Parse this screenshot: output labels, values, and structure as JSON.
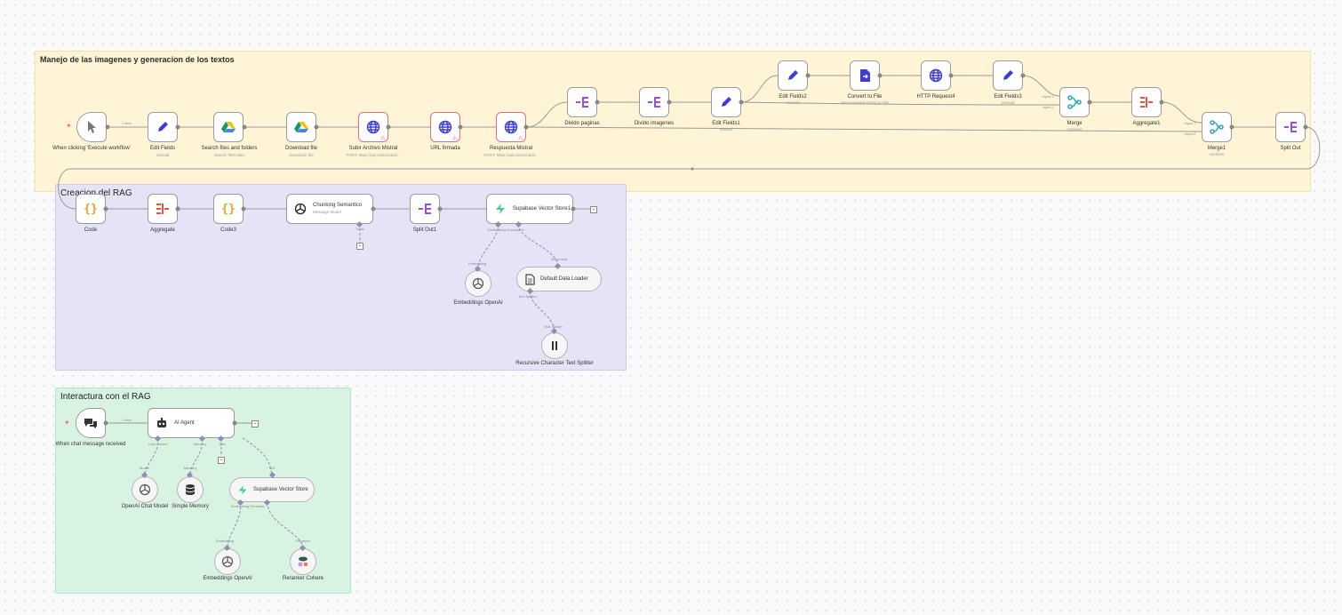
{
  "sticky": {
    "manejo": "Manejo de las imagenes y generacion de los textos",
    "rag": "Creacion del RAG",
    "interactura": "Interactura con el RAG"
  },
  "nodes": {
    "manual_trigger": "When clicking 'Execute workflow'",
    "edit_fields": "Edit Fields",
    "edit_fields_sub": "manual",
    "search_files": "Search files and folders",
    "search_files_sub": "search: fileFolder",
    "download_file": "Download file",
    "download_file_sub": "download: file",
    "subir": "Subir Archivo Mistral",
    "subir_sub": "POST: https://api.mistral.ai/vl...",
    "url_firmada": "URL firmada",
    "respuesta": "Respuesta Mistral",
    "respuesta_sub": "POST: https://api.mistral.ai/vl...",
    "divido_paginas": "Divido paginas",
    "divido_imagenes": "Divido imagenes",
    "edit_fields1": "Edit Fields1",
    "edit_fields1_sub": "manual",
    "edit_fields2": "Edit Fields2",
    "edit_fields2_sub": "manual",
    "convert": "Convert to File",
    "convert_sub": "Move Base64 String to File",
    "http4": "HTTP Request4",
    "edit_fields3": "Edit Fields3",
    "edit_fields3_sub": "manual",
    "merge": "Merge",
    "merge_sub": "combine",
    "aggregate1": "Aggregate1",
    "merge1": "Merge1",
    "merge1_sub": "combine",
    "split_out": "Split Out",
    "code": "Code",
    "aggregate": "Aggregate",
    "code3": "Code3",
    "chunking": "Chunking Semantico",
    "chunking_sub": "Message Model",
    "split_out1": "Split Out1",
    "supabase1": "Supabase Vector Store1",
    "embeddings_openai_rag": "Embeddings OpenAI",
    "default_loader": "Default Data Loader",
    "recursive": "Recursive Character Text Splitter",
    "chat_trigger": "When chat message received",
    "ai_agent": "AI Agent",
    "openai_chat": "OpenAI Chat Model",
    "simple_memory": "Simple Memory",
    "supabase_store": "Supabase Vector Store",
    "embeddings_openai": "Embeddings OpenAI",
    "reranker": "Reranker Cohere"
  },
  "edges": {
    "one_item": "1 item",
    "one_item_b": "1 item",
    "input1": "Input 1",
    "input2": "Input 2",
    "input1b": "Input 1",
    "input2b": "Input 2",
    "tools": "Tools",
    "embedding_doc": "Embedding  Document*",
    "embedding": "Embedding",
    "document": "Document",
    "text_splitter": "Text Splitter",
    "text_splitter2": "Text Splitter",
    "chat_model": "Chat Model*",
    "memory": "Memory",
    "tool": "Tool",
    "model": "Model",
    "memory2": "Memory",
    "tool2": "Tool",
    "emb_reranker": "Embedding  Reranker",
    "embedding2": "Embedding",
    "reranker_l": "Reranker"
  },
  "colors": {
    "sticky_yellow": "#fff5d6",
    "sticky_purple": "#e6e3f6",
    "sticky_green": "#d9f3e3",
    "accent": "#ff6d5a"
  }
}
